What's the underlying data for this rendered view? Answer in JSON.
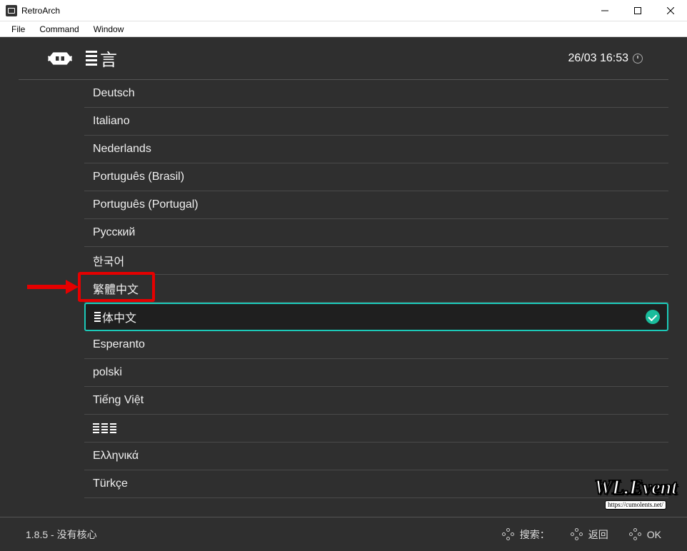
{
  "window": {
    "title": "RetroArch"
  },
  "menubar": {
    "items": [
      "File",
      "Command",
      "Window"
    ]
  },
  "header": {
    "lang_glyph": "言",
    "datetime": "26/03 16:53"
  },
  "languages": [
    {
      "label": "Deutsch"
    },
    {
      "label": "Italiano"
    },
    {
      "label": "Nederlands"
    },
    {
      "label": "Português (Brasil)"
    },
    {
      "label": "Português (Portugal)"
    },
    {
      "label": "Русский"
    },
    {
      "label": "한국어"
    },
    {
      "label": "繁體中文",
      "highlighted": true
    },
    {
      "label": "体中文",
      "prefix_bars": true,
      "selected": true
    },
    {
      "label": "Esperanto"
    },
    {
      "label": "polski"
    },
    {
      "label": "Tiếng Việt"
    },
    {
      "label": "",
      "triple_bars": true
    },
    {
      "label": "Ελληνικά"
    },
    {
      "label": "Türkçe"
    }
  ],
  "footer": {
    "status": "1.8.5 - 没有核心",
    "actions": [
      {
        "label": "搜索："
      },
      {
        "label": "返回"
      },
      {
        "label": "OK"
      }
    ]
  },
  "watermark": {
    "big": "WL.Event",
    "small": "https://cumolents.net/"
  }
}
